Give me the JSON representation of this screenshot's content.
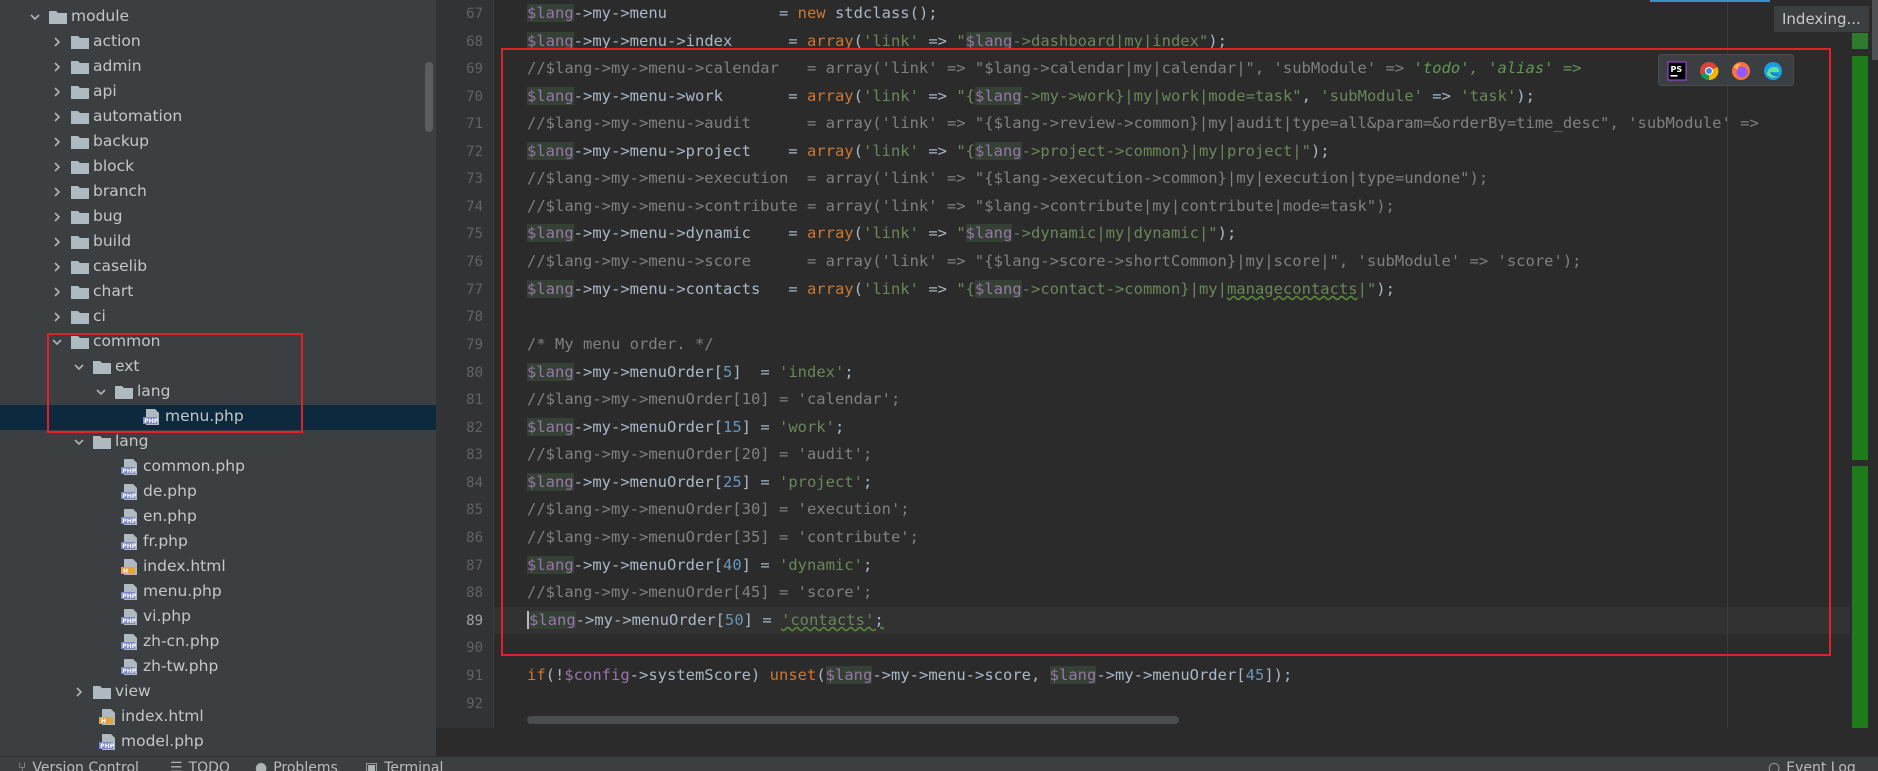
{
  "ide": {
    "indexing_label": "Indexing..."
  },
  "project_tree": {
    "rows": [
      {
        "label": "module",
        "kind": "folder",
        "open": true,
        "depth": 0
      },
      {
        "label": "action",
        "kind": "folder",
        "open": false,
        "depth": 1
      },
      {
        "label": "admin",
        "kind": "folder",
        "open": false,
        "depth": 1
      },
      {
        "label": "api",
        "kind": "folder",
        "open": false,
        "depth": 1
      },
      {
        "label": "automation",
        "kind": "folder",
        "open": false,
        "depth": 1
      },
      {
        "label": "backup",
        "kind": "folder",
        "open": false,
        "depth": 1
      },
      {
        "label": "block",
        "kind": "folder",
        "open": false,
        "depth": 1
      },
      {
        "label": "branch",
        "kind": "folder",
        "open": false,
        "depth": 1
      },
      {
        "label": "bug",
        "kind": "folder",
        "open": false,
        "depth": 1
      },
      {
        "label": "build",
        "kind": "folder",
        "open": false,
        "depth": 1
      },
      {
        "label": "caselib",
        "kind": "folder",
        "open": false,
        "depth": 1
      },
      {
        "label": "chart",
        "kind": "folder",
        "open": false,
        "depth": 1
      },
      {
        "label": "ci",
        "kind": "folder",
        "open": false,
        "depth": 1
      },
      {
        "label": "common",
        "kind": "folder",
        "open": true,
        "depth": 1
      },
      {
        "label": "ext",
        "kind": "folder",
        "open": true,
        "depth": 2
      },
      {
        "label": "lang",
        "kind": "folder",
        "open": true,
        "depth": 3
      },
      {
        "label": "menu.php",
        "kind": "php",
        "depth": 4,
        "selected": true
      },
      {
        "label": "lang",
        "kind": "folder",
        "open": true,
        "depth": 2
      },
      {
        "label": "common.php",
        "kind": "php",
        "depth": 3
      },
      {
        "label": "de.php",
        "kind": "php",
        "depth": 3
      },
      {
        "label": "en.php",
        "kind": "php",
        "depth": 3
      },
      {
        "label": "fr.php",
        "kind": "php",
        "depth": 3
      },
      {
        "label": "index.html",
        "kind": "html",
        "depth": 3
      },
      {
        "label": "menu.php",
        "kind": "php",
        "depth": 3
      },
      {
        "label": "vi.php",
        "kind": "php",
        "depth": 3
      },
      {
        "label": "zh-cn.php",
        "kind": "php",
        "depth": 3
      },
      {
        "label": "zh-tw.php",
        "kind": "php",
        "depth": 3
      },
      {
        "label": "view",
        "kind": "folder",
        "open": false,
        "depth": 2
      },
      {
        "label": "index.html",
        "kind": "html",
        "depth": 2
      },
      {
        "label": "model.php",
        "kind": "php",
        "depth": 2
      }
    ]
  },
  "editor": {
    "line_numbers": [
      "67",
      "68",
      "69",
      "70",
      "71",
      "72",
      "73",
      "74",
      "75",
      "76",
      "77",
      "78",
      "79",
      "80",
      "81",
      "82",
      "83",
      "84",
      "85",
      "86",
      "87",
      "88",
      "89",
      "90",
      "91",
      "92"
    ],
    "current_line": "89",
    "lines": {
      "l67": {
        "v": "$lang",
        "a": "->my->menu            = ",
        "k": "new",
        "b": " stdclass();"
      },
      "l68": {
        "v": "$lang",
        "a": "->my->menu->index      = ",
        "k": "array",
        "b": "(",
        "s1": "'link'",
        "c": " => ",
        "s2a": "\"",
        "v2": "$lang",
        "s2b": "->dashboard|my|index\"",
        "e": ");"
      },
      "l69": {
        "c1": "//$lang->my->menu->calendar   = array('link' => \"$lang->calendar|my|calendar|\", 'subModule' => ",
        "i1": "'todo', 'alias' =>"
      },
      "l70": {
        "v": "$lang",
        "a": "->my->menu->work       = ",
        "k": "array",
        "b": "(",
        "s1": "'link'",
        "c": " => ",
        "s2a": "\"{",
        "v2": "$lang",
        "s2b": "->my->work}|my|work|mode=task\"",
        "d": ", ",
        "s3": "'subModule'",
        "c2": " => ",
        "s4": "'task'",
        "e": ");"
      },
      "l71": {
        "c1": "//$lang->my->menu->audit      = array('link' => \"{$lang->review->common}|my|audit|type=all&param=&orderBy=time_desc\", 'subModule' =>"
      },
      "l72": {
        "v": "$lang",
        "a": "->my->menu->project    = ",
        "k": "array",
        "b": "(",
        "s1": "'link'",
        "c": " => ",
        "s2a": "\"{",
        "v2": "$lang",
        "s2b": "->project->common}|my|project|\"",
        "e": ");"
      },
      "l73": {
        "c1": "//$lang->my->menu->execution  = array('link' => \"{$lang->execution->common}|my|execution|type=undone\");"
      },
      "l74": {
        "c1": "//$lang->my->menu->contribute = array('link' => \"$lang->contribute|my|contribute|mode=task\");"
      },
      "l75": {
        "v": "$lang",
        "a": "->my->menu->dynamic    = ",
        "k": "array",
        "b": "(",
        "s1": "'link'",
        "c": " => ",
        "s2a": "\"",
        "v2": "$lang",
        "s2b": "->dynamic|my|dynamic|\"",
        "e": ");"
      },
      "l76": {
        "c1": "//$lang->my->menu->score      = array('link' => \"{$lang->score->shortCommon}|my|score|\", 'subModule' => 'score');"
      },
      "l77": {
        "v": "$lang",
        "a": "->my->menu->contacts   = ",
        "k": "array",
        "b": "(",
        "s1": "'link'",
        "c": " => ",
        "s2a": "\"{",
        "v2": "$lang",
        "s2b": "->contact->common}|my|",
        "sq": "managecontacts",
        "s2c": "|\"",
        "e": ");"
      },
      "l79": {
        "c1": "/* My menu order. */"
      },
      "l80": {
        "v": "$lang",
        "a": "->my->menuOrder[",
        "n": "5",
        "b": "]  = ",
        "s1": "'index'",
        "e": ";"
      },
      "l81": {
        "c1": "//$lang->my->menuOrder[10] = 'calendar';"
      },
      "l82": {
        "v": "$lang",
        "a": "->my->menuOrder[",
        "n": "15",
        "b": "] = ",
        "s1": "'work'",
        "e": ";"
      },
      "l83": {
        "c1": "//$lang->my->menuOrder[20] = 'audit';"
      },
      "l84": {
        "v": "$lang",
        "a": "->my->menuOrder[",
        "n": "25",
        "b": "] = ",
        "s1": "'project'",
        "e": ";"
      },
      "l85": {
        "c1": "//$lang->my->menuOrder[30] = 'execution';"
      },
      "l86": {
        "c1": "//$lang->my->menuOrder[35] = 'contribute';"
      },
      "l87": {
        "v": "$lang",
        "a": "->my->menuOrder[",
        "n": "40",
        "b": "] = ",
        "s1": "'dynamic'",
        "e": ";"
      },
      "l88": {
        "c1": "//$lang->my->menuOrder[45] = 'score';"
      },
      "l89": {
        "v": "$lang",
        "a": "->my->menuOrder[",
        "n": "50",
        "b": "] = ",
        "s1": "'contacts'",
        "e": ";"
      },
      "l91": {
        "k": "if",
        "a": "(!",
        "v": "$config",
        "b": "->systemScore) ",
        "k2": "unset",
        "c": "(",
        "v2": "$lang",
        "d": "->my->menu->score, ",
        "v3": "$lang",
        "f": "->my->menuOrder[",
        "n": "45",
        "e": "]);"
      }
    }
  },
  "bottom_bar": {
    "version_control": "Version Control",
    "todo": "TODO",
    "problems": "Problems",
    "terminal": "Terminal",
    "event_log": "Event Log"
  },
  "colors": {
    "annotation_red": "#e0202a",
    "selection": "#0d293e",
    "stripe_green": "#1f7a1a"
  },
  "browser_icons": [
    "phpstorm-icon",
    "chrome-icon",
    "firefox-icon",
    "edge-icon"
  ]
}
